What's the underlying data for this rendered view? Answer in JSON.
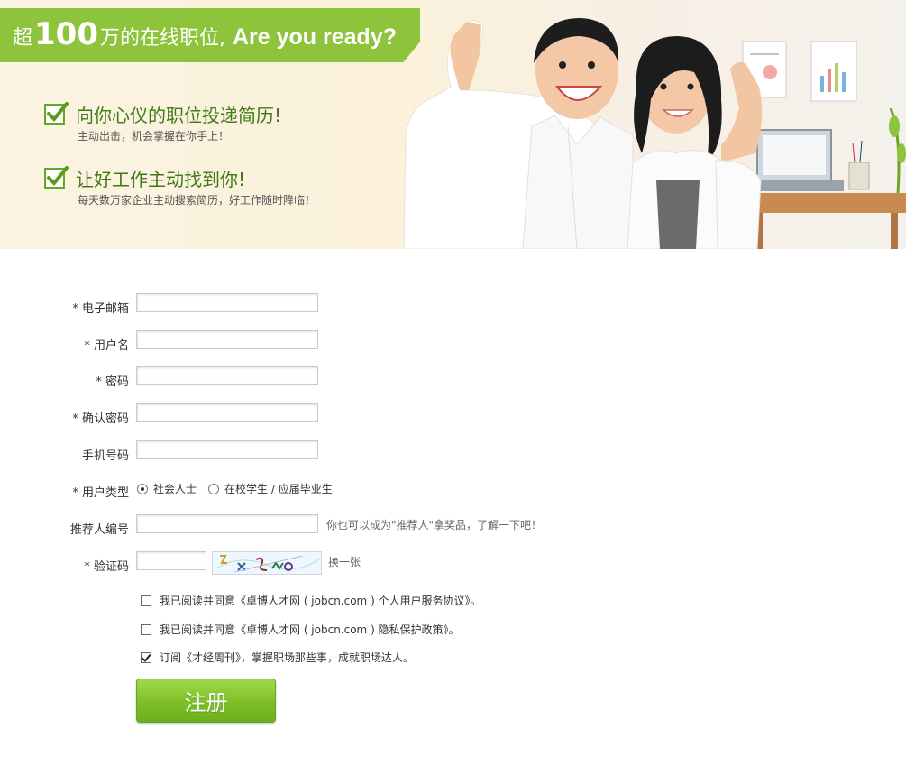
{
  "banner": {
    "headline_pre": "超",
    "headline_num": "100",
    "headline_post": "万的在线职位,",
    "headline_en": "Are you ready?",
    "features": [
      {
        "title": "向你心仪的职位投递简历!",
        "subtitle": "主动出击，机会掌握在你手上！"
      },
      {
        "title": "让好工作主动找到你!",
        "subtitle": "每天数万家企业主动搜索简历，好工作随时降临！"
      }
    ],
    "accent_color": "#8dc43b"
  },
  "form": {
    "email_label": "* 电子邮箱",
    "username_label": "* 用户名",
    "password_label": "* 密码",
    "confirm_label": "* 确认密码",
    "phone_label": "手机号码",
    "usertype_label": "* 用户类型",
    "usertype_options": [
      "社会人士",
      "在校学生 / 应届毕业生"
    ],
    "usertype_selected": "社会人士",
    "referrer_label": "推荐人编号",
    "referrer_hint": "你也可以成为\"推荐人\"拿奖品，了解一下吧！",
    "captcha_label": "* 验证码",
    "captcha_refresh": "换一张",
    "agree_terms": "我已阅读并同意《卓博人才网 ( jobcn.com ) 个人用户服务协议》。",
    "agree_privacy": "我已阅读并同意《卓博人才网 ( jobcn.com ) 隐私保护政策》。",
    "subscribe": "订阅《才经周刊》，掌握职场那些事，成就职场达人。",
    "agree_terms_checked": false,
    "agree_privacy_checked": false,
    "subscribe_checked": true,
    "submit_label": "注册"
  }
}
